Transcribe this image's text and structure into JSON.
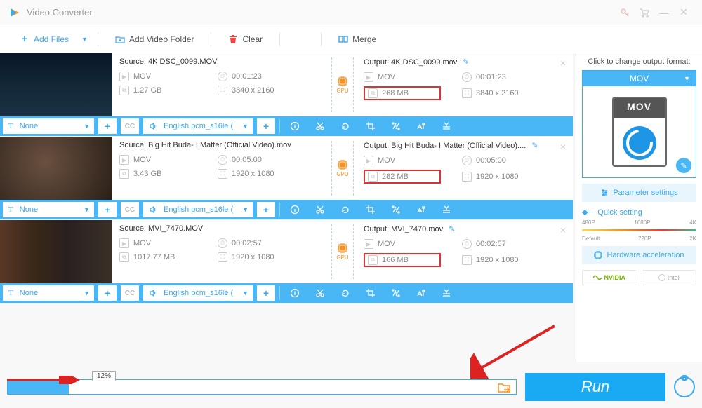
{
  "title": "Video Converter",
  "toolbar": {
    "add_files": "Add Files",
    "add_folder": "Add Video Folder",
    "clear": "Clear",
    "merge": "Merge"
  },
  "items": [
    {
      "source_label": "Source: 4K DSC_0099.MOV",
      "src_format": "MOV",
      "src_duration": "00:01:23",
      "src_size": "1.27 GB",
      "src_dim": "3840 x 2160",
      "output_label": "Output: 4K DSC_0099.mov",
      "out_format": "MOV",
      "out_duration": "00:01:23",
      "out_size": "268 MB",
      "out_dim": "3840 x 2160",
      "subtitle": "None",
      "audio": "English pcm_s16le ( "
    },
    {
      "source_label": "Source: Big Hit Buda- I Matter (Official Video).mov",
      "src_format": "MOV",
      "src_duration": "00:05:00",
      "src_size": "3.43 GB",
      "src_dim": "1920 x 1080",
      "output_label": "Output: Big Hit Buda- I Matter (Official Video)....",
      "out_format": "MOV",
      "out_duration": "00:05:00",
      "out_size": "282 MB",
      "out_dim": "1920 x 1080",
      "subtitle": "None",
      "audio": "English pcm_s16le ( "
    },
    {
      "source_label": "Source: MVI_7470.MOV",
      "src_format": "MOV",
      "src_duration": "00:02:57",
      "src_size": "1017.77 MB",
      "src_dim": "1920 x 1080",
      "output_label": "Output: MVI_7470.mov",
      "out_format": "MOV",
      "out_duration": "00:02:57",
      "out_size": "166 MB",
      "out_dim": "1920 x 1080",
      "subtitle": "None",
      "audio": "English pcm_s16le ( "
    }
  ],
  "side": {
    "label": "Click to change output format:",
    "format": "MOV",
    "mov_text": "MOV",
    "param_btn": "Parameter settings",
    "quick": "Quick setting",
    "ticks_top": [
      "480P",
      "1080P",
      "4K"
    ],
    "ticks_bottom": [
      "Default",
      "720P",
      "2K"
    ],
    "hw_btn": "Hardware acceleration",
    "nvidia": "NVIDIA",
    "intel": "Intel"
  },
  "bottom": {
    "pct": "12%",
    "run": "Run"
  },
  "gpu_label": "GPU"
}
